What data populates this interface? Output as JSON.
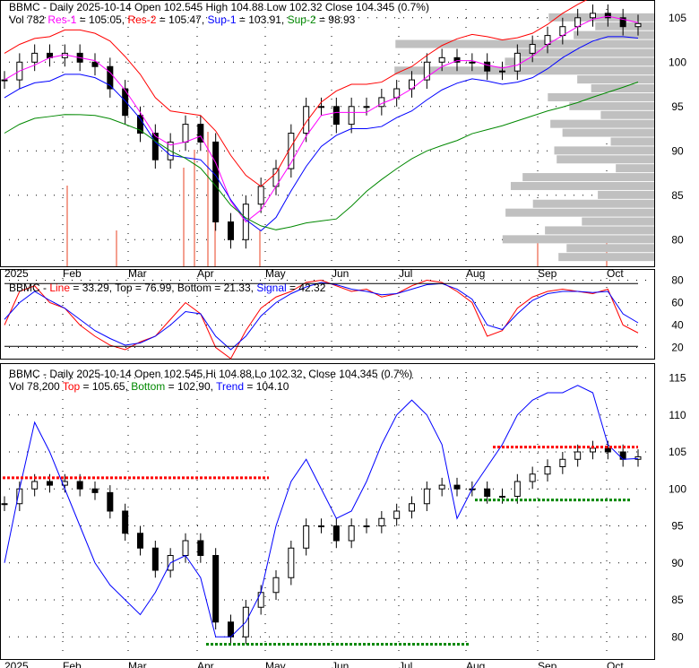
{
  "colors": {
    "magenta": "#ff00ff",
    "red": "#ff0000",
    "blue": "#0000ff",
    "green": "#008800",
    "volume": "#f4a090",
    "profile": "#c0c0c0"
  },
  "panel1": {
    "line1": "BBMC - Daily 2025-10-14 Open 102.545  High 104.88  Low 102.32  Close 104.345 (0.7%)",
    "vol": "Vol 782",
    "res1_label": "Res-1",
    "res1": " = 105.05, ",
    "res2_label": "Res-2",
    "res2": " = 105.47, ",
    "sup1_label": "Sup-1",
    "sup1": " = 103.91, ",
    "sup2_label": "Sup-2",
    "sup2": " = 98.93"
  },
  "panel2": {
    "title": "BBMC",
    "line_label": "Line",
    "line": " = 33.29, ",
    "top_label": "Top",
    "top": " = 76.99, ",
    "bottom_label": "Bottom",
    "bottom": " = 21.33, ",
    "signal_label": "Signal",
    "signal": " = 42.32"
  },
  "panel3": {
    "line1": "BBMC - Daily 2025-10-14 Open 102.545,Hi 104.88,Lo 102.32, Close 104.345 (0.7%)",
    "vol": "Vol 78,200 ",
    "top_label": "Top",
    "top": " = 105.65, ",
    "bottom_label": "Bottom",
    "bottom": " = 102.90, ",
    "trend_label": "Trend",
    "trend": " = 104.10"
  },
  "chart_data": {
    "type": "line",
    "x_labels": [
      "2025",
      "Feb",
      "Mar",
      "Apr",
      "May",
      "Jun",
      "Jul",
      "Aug",
      "Sep",
      "Oct"
    ],
    "close": [
      98,
      100,
      101,
      100.5,
      101,
      100,
      99.5,
      97,
      94,
      92,
      89,
      91,
      93,
      91,
      82,
      80,
      84,
      86,
      88,
      92,
      95,
      95,
      93,
      95,
      95,
      96,
      97,
      98,
      100,
      100.5,
      100,
      100,
      99,
      99,
      101,
      102,
      103,
      104,
      105,
      105.5,
      105,
      104,
      104.345
    ],
    "panel1_yticks": [
      80,
      85,
      90,
      95,
      100,
      105
    ],
    "panel1_ylim": [
      77,
      107
    ],
    "panel2_yticks": [
      20,
      40,
      60,
      80
    ],
    "panel2_ylim": [
      10,
      90
    ],
    "panel3_yticks": [
      80,
      85,
      90,
      95,
      100,
      105,
      110,
      115
    ],
    "panel3_ylim": [
      77,
      117
    ],
    "oscillator_line": [
      40,
      70,
      75,
      60,
      55,
      40,
      30,
      22,
      18,
      25,
      30,
      45,
      60,
      50,
      20,
      10,
      35,
      55,
      65,
      70,
      78,
      80,
      75,
      70,
      72,
      65,
      68,
      75,
      80,
      78,
      70,
      60,
      30,
      35,
      55,
      65,
      70,
      72,
      70,
      68,
      72,
      40,
      33
    ],
    "oscillator_signal": [
      45,
      60,
      70,
      62,
      55,
      45,
      35,
      28,
      22,
      24,
      30,
      40,
      52,
      50,
      30,
      18,
      30,
      48,
      60,
      68,
      74,
      78,
      76,
      72,
      70,
      67,
      68,
      72,
      76,
      77,
      72,
      63,
      40,
      36,
      50,
      62,
      68,
      70,
      70,
      69,
      70,
      50,
      42
    ],
    "trend_line": [
      90,
      100,
      109,
      105,
      100,
      95,
      90,
      87,
      85,
      83,
      86,
      90,
      91,
      88,
      80,
      80,
      82,
      86,
      95,
      101,
      104,
      100,
      96,
      97,
      101,
      106,
      110,
      112,
      110,
      106,
      96,
      100,
      103,
      106,
      110,
      112,
      113,
      113,
      114,
      113,
      106,
      104,
      104.1
    ]
  }
}
